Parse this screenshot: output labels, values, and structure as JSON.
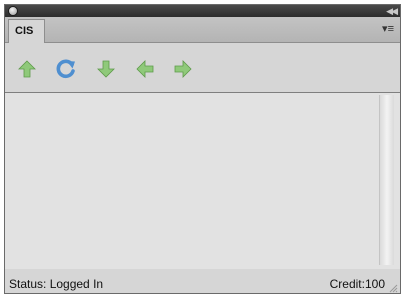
{
  "window": {
    "close_icon": "circle-close-icon",
    "collapse_icon": "double-chevron-left-icon",
    "collapse_glyph": "◀◀"
  },
  "tabs": [
    {
      "label": "CIS",
      "active": true
    }
  ],
  "panel_menu": {
    "icon": "panel-menu-icon",
    "glyph": "▾≡"
  },
  "toolbar": {
    "icon_color": "#8fc97a",
    "icon_stroke": "#5e9a4a",
    "buttons": [
      {
        "name": "up-arrow-button",
        "icon": "arrow-up-icon"
      },
      {
        "name": "refresh-button",
        "icon": "refresh-icon",
        "color": "#4f8fd0"
      },
      {
        "name": "down-arrow-button",
        "icon": "arrow-down-icon"
      },
      {
        "name": "back-arrow-button",
        "icon": "arrow-left-icon"
      },
      {
        "name": "forward-arrow-button",
        "icon": "arrow-right-icon"
      }
    ]
  },
  "status": {
    "text": "Status: Logged In",
    "credit": "Credit:100"
  }
}
